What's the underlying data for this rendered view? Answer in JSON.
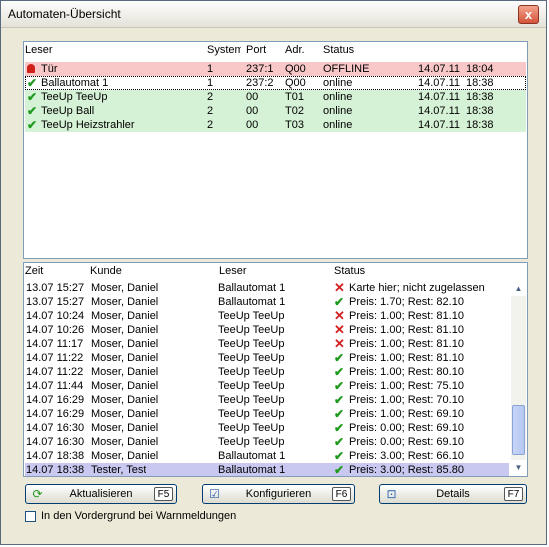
{
  "window": {
    "title": "Automaten-Übersicht",
    "close_glyph": "x"
  },
  "readers": {
    "headers": {
      "name": "Leser",
      "system": "System",
      "port": "Port",
      "addr": "Adr.",
      "status": "Status"
    },
    "rows": [
      {
        "icon": "bell-icon",
        "name": "Tür",
        "system": "1",
        "port": "237:1",
        "addr": "Q00",
        "status": "OFFLINE",
        "date": "14.07.11",
        "time": "18:04",
        "color": "red"
      },
      {
        "icon": "check-icon",
        "name": "Ballautomat 1",
        "system": "1",
        "port": "237:2",
        "addr": "Q00",
        "status": "online",
        "date": "14.07.11",
        "time": "18:38",
        "color": "selected"
      },
      {
        "icon": "check-icon",
        "name": "TeeUp TeeUp",
        "system": "2",
        "port": "00",
        "addr": "T01",
        "status": "online",
        "date": "14.07.11",
        "time": "18:38",
        "color": "green"
      },
      {
        "icon": "check-icon",
        "name": "TeeUp Ball",
        "system": "2",
        "port": "00",
        "addr": "T02",
        "status": "online",
        "date": "14.07.11",
        "time": "18:38",
        "color": "green"
      },
      {
        "icon": "check-icon",
        "name": "TeeUp Heizstrahler",
        "system": "2",
        "port": "00",
        "addr": "T03",
        "status": "online",
        "date": "14.07.11",
        "time": "18:38",
        "color": "green"
      }
    ]
  },
  "log": {
    "headers": {
      "time": "Zeit",
      "customer": "Kunde",
      "reader": "Leser",
      "status": "Status"
    },
    "rows": [
      {
        "time": "13.07 15:27",
        "customer": "Moser, Daniel",
        "reader": "Ballautomat 1",
        "ok": false,
        "status": "Karte hier; nicht zugelassen"
      },
      {
        "time": "13.07 15:27",
        "customer": "Moser, Daniel",
        "reader": "Ballautomat 1",
        "ok": true,
        "status": "Preis: 1.70; Rest: 82.10"
      },
      {
        "time": "14.07 10:24",
        "customer": "Moser, Daniel",
        "reader": "TeeUp TeeUp",
        "ok": false,
        "status": "Preis: 1.00; Rest: 81.10"
      },
      {
        "time": "14.07 10:26",
        "customer": "Moser, Daniel",
        "reader": "TeeUp TeeUp",
        "ok": false,
        "status": "Preis: 1.00; Rest: 81.10"
      },
      {
        "time": "14.07 11:17",
        "customer": "Moser, Daniel",
        "reader": "TeeUp TeeUp",
        "ok": false,
        "status": "Preis: 1.00; Rest: 81.10"
      },
      {
        "time": "14.07 11:22",
        "customer": "Moser, Daniel",
        "reader": "TeeUp TeeUp",
        "ok": true,
        "status": "Preis: 1.00; Rest: 81.10"
      },
      {
        "time": "14.07 11:22",
        "customer": "Moser, Daniel",
        "reader": "TeeUp TeeUp",
        "ok": true,
        "status": "Preis: 1.00; Rest: 80.10"
      },
      {
        "time": "14.07 11:44",
        "customer": "Moser, Daniel",
        "reader": "TeeUp TeeUp",
        "ok": true,
        "status": "Preis: 1.00; Rest: 75.10"
      },
      {
        "time": "14.07 16:29",
        "customer": "Moser, Daniel",
        "reader": "TeeUp TeeUp",
        "ok": true,
        "status": "Preis: 1.00; Rest: 70.10"
      },
      {
        "time": "14.07 16:29",
        "customer": "Moser, Daniel",
        "reader": "TeeUp TeeUp",
        "ok": true,
        "status": "Preis: 1.00; Rest: 69.10"
      },
      {
        "time": "14.07 16:30",
        "customer": "Moser, Daniel",
        "reader": "TeeUp TeeUp",
        "ok": true,
        "status": "Preis: 0.00; Rest: 69.10"
      },
      {
        "time": "14.07 16:30",
        "customer": "Moser, Daniel",
        "reader": "TeeUp TeeUp",
        "ok": true,
        "status": "Preis: 0.00; Rest: 69.10"
      },
      {
        "time": "14.07 18:38",
        "customer": "Moser, Daniel",
        "reader": "Ballautomat 1",
        "ok": true,
        "status": "Preis: 3.00; Rest: 66.10"
      },
      {
        "time": "14.07 18:38",
        "customer": "Tester, Test",
        "reader": "Ballautomat 1",
        "ok": true,
        "status": "Preis: 3.00; Rest: 85.80",
        "selected": true
      }
    ]
  },
  "buttons": [
    {
      "name": "refresh-button",
      "icon": "refresh-icon",
      "label": "Aktualisieren",
      "key": "F5"
    },
    {
      "name": "configure-button",
      "icon": "configure-icon",
      "label": "Konfigurieren",
      "key": "F6"
    },
    {
      "name": "details-button",
      "icon": "details-icon",
      "label": "Details",
      "key": "F7"
    }
  ],
  "checkbox": {
    "label": "In den Vordergrund bei Warnmeldungen",
    "checked": false
  },
  "colors": {
    "offline_row": "#f8c8c8",
    "online_row": "#d6f2d6",
    "selected_row": "#c8c8f0"
  }
}
